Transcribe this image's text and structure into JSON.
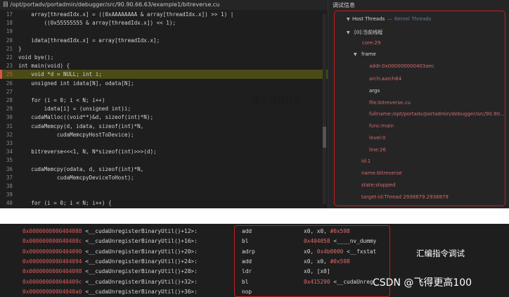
{
  "editor": {
    "path": "目 /opt/portadv/portadmin/debugger/src/90.90.66.63/example1/bitreverse.cu",
    "lines": [
      {
        "n": "17",
        "text": "    array[threadIdx.x] = ((0xAAAAAAAA & array[threadIdx.x]) >> 1) |"
      },
      {
        "n": "18",
        "text": "        ((0x55555555 & array[threadIdx.x]) << 1);"
      },
      {
        "n": "19",
        "text": ""
      },
      {
        "n": "20",
        "text": "    idata[threadIdx.x] = array[threadIdx.x];"
      },
      {
        "n": "21",
        "text": "}"
      },
      {
        "n": "22",
        "text": "void bye();"
      },
      {
        "n": "23",
        "text": "int main(void) {"
      },
      {
        "n": "25",
        "text": "    void *d = NULL; int i;",
        "highlight": true
      },
      {
        "n": "26",
        "text": "    unsigned int idata[N], odata[N];"
      },
      {
        "n": "27",
        "text": ""
      },
      {
        "n": "28",
        "text": "    for (i = 0; i < N; i++)"
      },
      {
        "n": "29",
        "text": "        idata[i] = (unsigned int)i;"
      },
      {
        "n": "30",
        "text": "    cudaMalloc((void**)&d, sizeof(int)*N);"
      },
      {
        "n": "31",
        "text": "    cudaMemcpy(d, idata, sizeof(int)*N,"
      },
      {
        "n": "32",
        "text": "            cudaMemcpyHostToDevice);"
      },
      {
        "n": "33",
        "text": ""
      },
      {
        "n": "34",
        "text": "    bitreverse<<<1, N, N*sizeof(int)>>>(d);"
      },
      {
        "n": "35",
        "text": ""
      },
      {
        "n": "36",
        "text": "    cudaMemcpy(odata, d, sizeof(int)*N,"
      },
      {
        "n": "37",
        "text": "            cudaMemcpyDeviceToHost);"
      },
      {
        "n": "38",
        "text": ""
      },
      {
        "n": "39",
        "text": ""
      },
      {
        "n": "40",
        "text": "    for (i = 0; i < N; i++) {"
      }
    ]
  },
  "callout_top": "展示线程信息",
  "debug_panel": {
    "title": "调试信息",
    "host_threads": "Host Threads",
    "kernel_threads": "Kernel Threads",
    "thread_node": "[0]:当前线程",
    "core": "core:29",
    "frame": "frame",
    "addr": "addr:0x000000000403aec",
    "arch": "arch:aarch64",
    "args": "args",
    "file": "file:bitreverse.cu",
    "fullname": "fullname:/opt/portadv/portadmin/debugger/src/90.90...",
    "func": "func:main",
    "level": "level:0",
    "line": "line:26",
    "id": "id:1",
    "name": "name:bitreverse",
    "state": "state:stopped",
    "target_id": "target-id:Thread 2938879.2938879"
  },
  "disasm": {
    "rows": [
      {
        "addr": "0x0000000000404088",
        "fn": "<__cudaUnregisterBinaryUtil()+12>:",
        "op": "add",
        "arg": "x0, x0, ",
        "hex": "#0x598",
        "tail": ""
      },
      {
        "addr": "0x000000000040408c",
        "fn": "<__cudaUnregisterBinaryUtil()+16>:",
        "op": "bl",
        "arg": "",
        "hex": "0x404058",
        "tail": " <____nv_dummy"
      },
      {
        "addr": "0x0000000000404090",
        "fn": "<__cudaUnregisterBinaryUtil()+20>:",
        "op": "adrp",
        "arg": "x0, ",
        "hex": "0x4b0000",
        "tail": " <__fxstat"
      },
      {
        "addr": "0x0000000000404094",
        "fn": "<__cudaUnregisterBinaryUtil()+24>:",
        "op": "add",
        "arg": "x0, x0, ",
        "hex": "#0x598",
        "tail": ""
      },
      {
        "addr": "0x0000000000404098",
        "fn": "<__cudaUnregisterBinaryUtil()+28>:",
        "op": "ldr",
        "arg": "x0, [x0]",
        "hex": "",
        "tail": ""
      },
      {
        "addr": "0x000000000040409c",
        "fn": "<__cudaUnregisterBinaryUtil()+32>:",
        "op": "bl",
        "arg": "",
        "hex": "0x415290",
        "tail": " <__cudaUnreg"
      },
      {
        "addr": "0x00000000004040a0",
        "fn": "<__cudaUnregisterBinaryUtil()+36>:",
        "op": "nop",
        "arg": "",
        "hex": "",
        "tail": ""
      }
    ]
  },
  "callout_bottom": "汇编指令调试",
  "watermark": "CSDN @飞得更高100"
}
